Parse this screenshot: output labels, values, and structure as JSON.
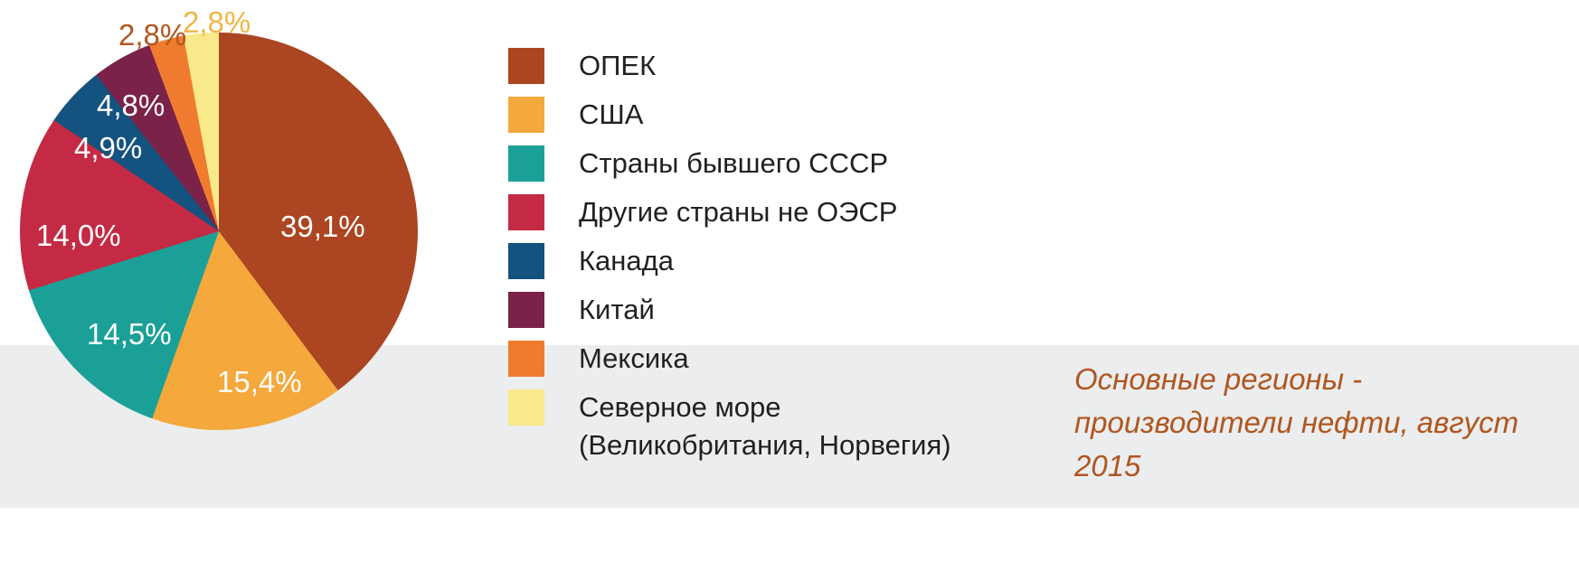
{
  "colors": {
    "background": "#ffffff",
    "band": "#ebedee",
    "caption_text": "#b0561f",
    "label_text": "#ffffff",
    "legend_text": "#231f20"
  },
  "caption": {
    "text": "Основные регионы - производители нефти, август 2015"
  },
  "legend": {
    "items": [
      {
        "label": "ОПЕК",
        "color": "#ab4522"
      },
      {
        "label": "США",
        "color": "#f5a83b"
      },
      {
        "label": "Страны бывшего СССР",
        "color": "#1ba098"
      },
      {
        "label": "Другие страны не  ОЭСР",
        "color": "#c42a43"
      },
      {
        "label": "Канада",
        "color": "#14527f"
      },
      {
        "label": "Китай",
        "color": "#7a2248"
      },
      {
        "label": "Мексика",
        "color": "#f07b2e"
      },
      {
        "label": "Северное море\n(Великобритания, Норвегия)",
        "color": "#f8e98a"
      }
    ]
  },
  "chart_data": {
    "type": "pie",
    "title": "Основные регионы - производители нефти, август 2015",
    "xlabel": "",
    "ylabel": "",
    "legend_position": "right",
    "grid": false,
    "categories": [
      "ОПЕК",
      "США",
      "Страны бывшего СССР",
      "Другие страны не  ОЭСР",
      "Канада",
      "Китай",
      "Мексика",
      "Северное море (Великобритания, Норвегия)"
    ],
    "values": [
      39.1,
      15.4,
      14.5,
      14.0,
      4.9,
      4.8,
      2.8,
      2.8
    ],
    "value_labels": [
      "39,1%",
      "15,4%",
      "14,5%",
      "14,0%",
      "4,9%",
      "4,8%",
      "2,8%",
      "2,8%"
    ],
    "colors": [
      "#ab4522",
      "#f5a83b",
      "#1ba098",
      "#c42a43",
      "#14527f",
      "#7a2248",
      "#f07b2e",
      "#f8e98a"
    ],
    "units": "percent",
    "start_angle_deg": 0,
    "direction": "clockwise"
  },
  "pie_labels": [
    {
      "text": "39,1%",
      "style": "inside"
    },
    {
      "text": "15,4%",
      "style": "inside"
    },
    {
      "text": "14,5%",
      "style": "inside"
    },
    {
      "text": "14,0%",
      "style": "inside"
    },
    {
      "text": "4,9%",
      "style": "inside"
    },
    {
      "text": "4,8%",
      "style": "inside"
    },
    {
      "text": "2,8%",
      "style": "outside-orange"
    },
    {
      "text": "2,8%",
      "style": "outside-yellow"
    }
  ]
}
